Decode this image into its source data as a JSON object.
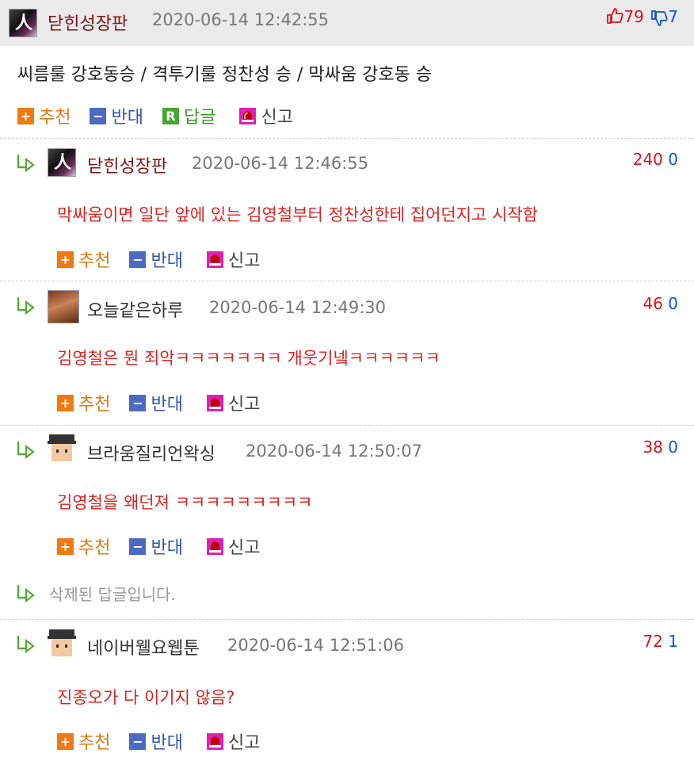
{
  "post": {
    "author": "닫힌성장판",
    "timestamp": "2020-06-14 12:42:55",
    "up": "79",
    "down": "7",
    "title": "씨름룰 강호동승 / 격투기룰 정찬성 승 / 막싸움 강호동 승"
  },
  "actions": {
    "recommend": "추천",
    "oppose": "반대",
    "reply": "답글",
    "report": "신고",
    "reply_box": "R"
  },
  "comments": [
    {
      "author": "닫힌성장판",
      "timestamp": "2020-06-14 12:46:55",
      "up": "240",
      "down": "0",
      "text": "막싸움이면 일단 앞에 있는 김영철부터 정찬성한테 집어던지고 시작함"
    },
    {
      "author": "오늘같은하루",
      "timestamp": "2020-06-14 12:49:30",
      "up": "46",
      "down": "0",
      "text": "김영철은 뭔 죄악ㅋㅋㅋㅋㅋㅋㅋ 개웃기넼ㅋㅋㅋㅋㅋㅋ"
    },
    {
      "author": "브라움질리언왁싱",
      "timestamp": "2020-06-14 12:50:07",
      "up": "38",
      "down": "0",
      "text": "김영철을 왜던져 ㅋㅋㅋㅋㅋㅋㅋㅋㅋ"
    },
    {
      "author": "네이버웰요웹툰",
      "timestamp": "2020-06-14 12:51:06",
      "up": "72",
      "down": "1",
      "text": "진종오가 다 이기지 않음?"
    }
  ],
  "deleted_comment": "삭제된 답글입니다.",
  "icons": {
    "thumbs_up": "thumbs-up-icon",
    "thumbs_down": "thumbs-down-icon",
    "reply_arrow": "reply-arrow-icon",
    "report": "siren-icon"
  },
  "colors": {
    "recommend": "#f07a12",
    "oppose": "#4d6ac2",
    "reply": "#4aa535",
    "report": "#e020b0",
    "comment_text": "#dd2222",
    "up_count": "#dd1122",
    "down_count": "#1155cc"
  }
}
